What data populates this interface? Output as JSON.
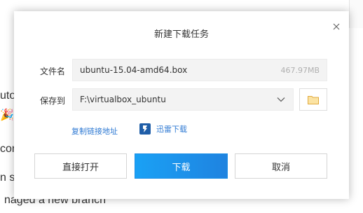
{
  "background": {
    "text_line_1": "uto",
    "text_line_2": "cor",
    "text_line_3": "n s",
    "text_line_4": "naged a new branch",
    "emoji": "🎉"
  },
  "dialog": {
    "title": "新建下载任务",
    "filename_label": "文件名",
    "filename_value": "ubuntu-15.04-amd64.box",
    "filesize": "467.97MB",
    "saveto_label": "保存到",
    "saveto_value": "F:\\virtualbox_ubuntu",
    "copy_link_label": "复制链接地址",
    "xunlei_label": "迅雷下载",
    "buttons": {
      "open_directly": "直接打开",
      "download": "下载",
      "cancel": "取消"
    }
  },
  "colors": {
    "primary_button": "#1a96ee",
    "link": "#2f7ad3",
    "folder_icon": "#f2c057"
  },
  "icons": {
    "close": "close-icon",
    "dropdown": "chevron-down-icon",
    "folder": "folder-icon",
    "xunlei": "xunlei-icon"
  }
}
